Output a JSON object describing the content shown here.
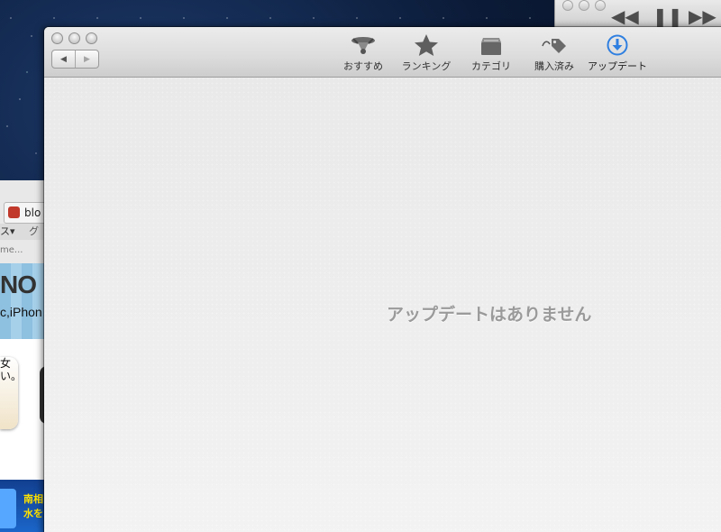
{
  "background": {
    "itunes": {
      "controls": [
        "◀◀",
        "❚❚",
        "▶▶"
      ]
    },
    "safari": {
      "tab_title": "blo",
      "bookmarks_left": "ス▾",
      "bookmarks_right": "グ",
      "url_fragment": "me...",
      "banner_title": "NO",
      "banner_subtitle": "c,iPhon",
      "card_line1": "女",
      "card_line2": "い。",
      "ad_line1": "南相",
      "ad_line2": "水を"
    }
  },
  "app_window": {
    "nav": {
      "back_icon": "◀",
      "forward_icon": "▶"
    },
    "toolbar": [
      {
        "label": "おすすめ",
        "icon": "featured-icon"
      },
      {
        "label": "ランキング",
        "icon": "star-icon"
      },
      {
        "label": "カテゴリ",
        "icon": "categories-icon"
      },
      {
        "label": "購入済み",
        "icon": "price-tag-icon"
      },
      {
        "label": "アップデート",
        "icon": "download-arrow-icon"
      }
    ],
    "main": {
      "empty_message": "アップデートはありません"
    },
    "colors": {
      "accent_blue": "#2f7fe0",
      "empty_text": "#9a9a9a"
    }
  }
}
